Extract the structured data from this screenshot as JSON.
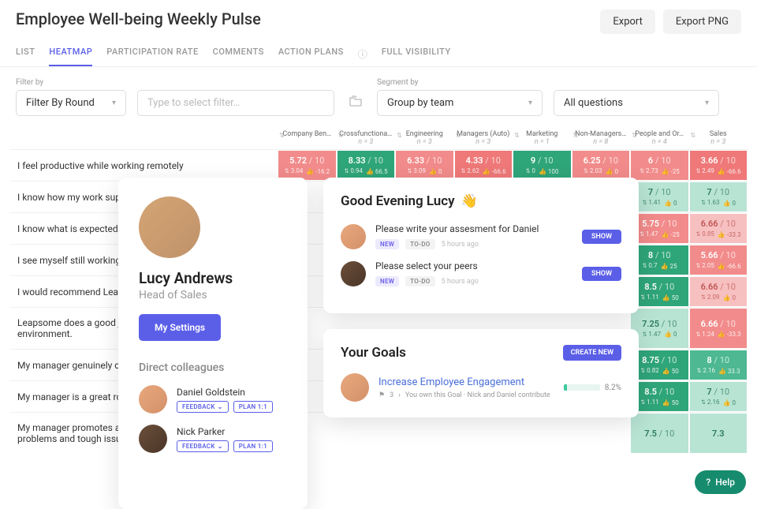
{
  "title": "Employee Well-being Weekly Pulse",
  "header_buttons": {
    "export": "Export",
    "export_png": "Export PNG"
  },
  "tabs": [
    "LIST",
    "HEATMAP",
    "PARTICIPATION RATE",
    "COMMENTS",
    "ACTION PLANS",
    "FULL VISIBILITY"
  ],
  "active_tab": 1,
  "filters": {
    "filter_by_label": "Filter by",
    "filter_by_value": "Filter By Round",
    "filter_search_placeholder": "Type to select filter…",
    "segment_label": "Segment by",
    "segment_value": "Group by team",
    "questions_value": "All questions"
  },
  "columns": [
    {
      "name": "Company Ben…",
      "n": ""
    },
    {
      "name": "Crossfunctiona…",
      "n": "n = 3"
    },
    {
      "name": "Engineering",
      "n": "n = 3"
    },
    {
      "name": "Managers (Auto)",
      "n": "n = 3"
    },
    {
      "name": "Marketing",
      "n": "n = 1"
    },
    {
      "name": "Non-Managers…",
      "n": "n = 8"
    },
    {
      "name": "People and Or…",
      "n": "n = 4"
    },
    {
      "name": "Sales",
      "n": "n = 3"
    }
  ],
  "rows": [
    {
      "q": "I feel productive while working remotely",
      "cells": [
        {
          "c": "c-red",
          "v": "5.72",
          "d": "/ 10",
          "s1": "3.04",
          "s2": "-16.2"
        },
        {
          "c": "c-green",
          "v": "8.33",
          "d": "/ 10",
          "s1": "0.94",
          "s2": "66.5"
        },
        {
          "c": "c-red",
          "v": "6.33",
          "d": "/ 10",
          "s1": "3.09",
          "s2": "0"
        },
        {
          "c": "c-red2",
          "v": "4.33",
          "d": "/ 10",
          "s1": "2.62",
          "s2": "-66.6"
        },
        {
          "c": "c-green",
          "v": "9",
          "d": "/ 10",
          "s1": "0",
          "s2": "100"
        },
        {
          "c": "c-red",
          "v": "6.25",
          "d": "/ 10",
          "s1": "2.03",
          "s2": "0"
        },
        {
          "c": "c-red",
          "v": "6",
          "d": "/ 10",
          "s1": "2.73",
          "s2": "-25"
        },
        {
          "c": "c-red2",
          "v": "3.66",
          "d": "/ 10",
          "s1": "2.49",
          "s2": "-66.6"
        }
      ]
    },
    {
      "q": "I know how my work suppo",
      "cells": [
        null,
        null,
        null,
        null,
        null,
        null,
        {
          "c": "c-lgreen",
          "v": "7",
          "d": "/ 10",
          "s1": "1.41",
          "s2": "0"
        },
        {
          "c": "c-lgreen",
          "v": "7",
          "d": "/ 10",
          "s1": "1.63",
          "s2": "0"
        }
      ]
    },
    {
      "q": "I know what is expected of",
      "cells": [
        null,
        null,
        null,
        null,
        null,
        null,
        {
          "c": "c-red",
          "v": "5.75",
          "d": "/ 10",
          "s1": "1.47",
          "s2": "-25"
        },
        {
          "c": "c-lred",
          "v": "6.66",
          "d": "/ 10",
          "s1": "0.85",
          "s2": "-33.3"
        }
      ]
    },
    {
      "q": "I see myself still working at",
      "cells": [
        null,
        null,
        null,
        null,
        null,
        null,
        {
          "c": "c-green",
          "v": "8",
          "d": "/ 10",
          "s1": "0.7",
          "s2": "25"
        },
        {
          "c": "c-red",
          "v": "5.66",
          "d": "/ 10",
          "s1": "2.05",
          "s2": "-66.6"
        }
      ]
    },
    {
      "q": "I would recommend Leapso",
      "cells": [
        null,
        null,
        null,
        null,
        null,
        null,
        {
          "c": "c-green",
          "v": "8.5",
          "d": "/ 10",
          "s1": "1.11",
          "s2": "50"
        },
        {
          "c": "c-lred",
          "v": "6.66",
          "d": "/ 10",
          "s1": "2.09",
          "s2": "0"
        }
      ]
    },
    {
      "q": "Leapsome does a good job\nenvironment.",
      "cells": [
        null,
        null,
        null,
        null,
        null,
        null,
        {
          "c": "c-lgreen",
          "v": "7.25",
          "d": "/ 10",
          "s1": "1.47",
          "s2": "0"
        },
        {
          "c": "c-red",
          "v": "6.66",
          "d": "/ 10",
          "s1": "1.24",
          "s2": "-33.3"
        }
      ]
    },
    {
      "q": "My manager genuinely care",
      "cells": [
        null,
        null,
        null,
        null,
        null,
        null,
        {
          "c": "c-green",
          "v": "8.75",
          "d": "/ 10",
          "s1": "0.82",
          "s2": "50"
        },
        {
          "c": "c-green2",
          "v": "8",
          "d": "/ 10",
          "s1": "2.16",
          "s2": "33.3"
        }
      ]
    },
    {
      "q": "My manager is a great role",
      "cells": [
        null,
        null,
        null,
        null,
        null,
        null,
        {
          "c": "c-green",
          "v": "8.5",
          "d": "/ 10",
          "s1": "1.11",
          "s2": "50"
        },
        {
          "c": "c-lgreen",
          "v": "7",
          "d": "/ 10",
          "s1": "2.16",
          "s2": "0"
        }
      ]
    },
    {
      "q": "My manager promotes an o\nproblems and tough issues.",
      "cells": [
        null,
        null,
        null,
        null,
        null,
        null,
        {
          "c": "c-lgreen",
          "v": "7.5",
          "d": "/ 10",
          "s1": "",
          "s2": ""
        },
        {
          "c": "c-lgreen",
          "v": "7.3",
          "d": "",
          "s1": "",
          "s2": ""
        }
      ]
    }
  ],
  "profile": {
    "name": "Lucy Andrews",
    "role": "Head of Sales",
    "settings_btn": "My Settings",
    "colleagues_label": "Direct colleagues",
    "colleagues": [
      {
        "name": "Daniel Goldstein"
      },
      {
        "name": "Nick Parker"
      }
    ],
    "feedback_btn": "FEEDBACK",
    "plan_btn": "PLAN 1:1"
  },
  "greeting": {
    "text": "Good Evening Lucy",
    "emoji": "👋",
    "tasks": [
      {
        "title": "Please write your assesment for Daniel",
        "badges": [
          "NEW",
          "TO-DO"
        ],
        "time": "5 hours ago",
        "action": "SHOW"
      },
      {
        "title": "Please select your peers",
        "badges": [
          "NEW",
          "TO-DO"
        ],
        "time": "5 hours ago",
        "action": "SHOW"
      }
    ]
  },
  "goals": {
    "heading": "Your Goals",
    "create_btn": "CREATE NEW",
    "items": [
      {
        "title": "Increase Employee Engagement",
        "flag": "⚑",
        "count": "3",
        "desc": "You own this Goal · Nick and Daniel contribute",
        "pct": "8.2%",
        "pct_fill": 8.2
      }
    ]
  },
  "help": "Help"
}
